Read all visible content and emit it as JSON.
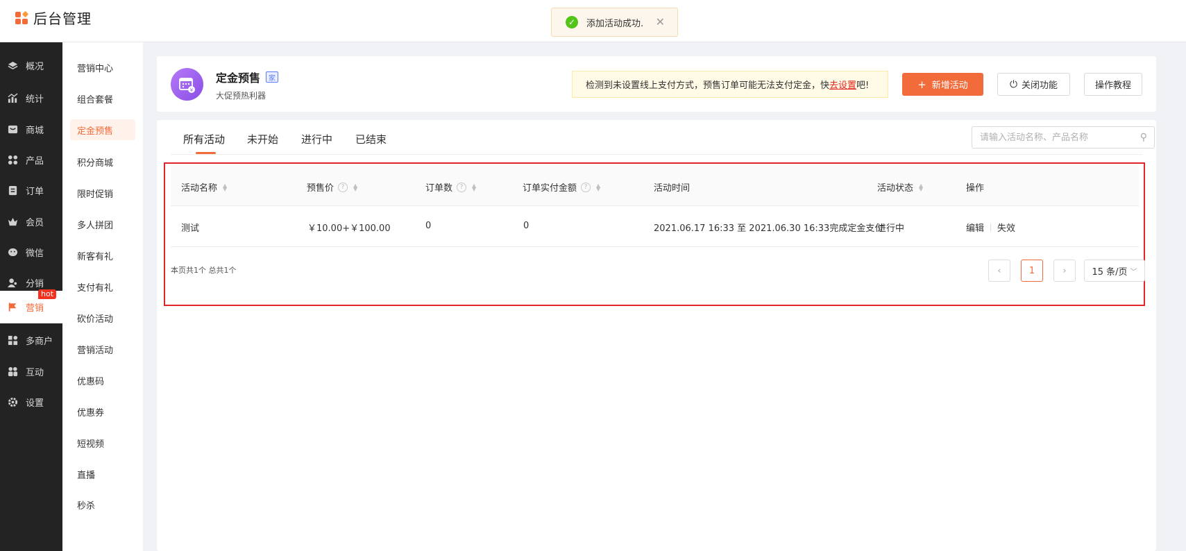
{
  "app": {
    "title": "后台管理"
  },
  "toast": {
    "text": "添加活动成功."
  },
  "sidebar": {
    "items": [
      {
        "label": "概况",
        "icon": "layers-icon"
      },
      {
        "label": "统计",
        "icon": "stats-icon"
      },
      {
        "label": "商城",
        "icon": "store-icon"
      },
      {
        "label": "产品",
        "icon": "product-icon"
      },
      {
        "label": "订单",
        "icon": "order-icon"
      },
      {
        "label": "会员",
        "icon": "crown-icon"
      },
      {
        "label": "微信",
        "icon": "wechat-icon"
      },
      {
        "label": "分销",
        "icon": "distribution-icon"
      },
      {
        "label": "营销",
        "icon": "flag-icon",
        "badge": "hot",
        "active": true
      },
      {
        "label": "多商户",
        "icon": "merchant-icon"
      },
      {
        "label": "互动",
        "icon": "interaction-icon"
      },
      {
        "label": "设置",
        "icon": "gear-icon"
      }
    ]
  },
  "subnav": {
    "items": [
      "营销中心",
      "组合套餐",
      "定金预售",
      "积分商城",
      "限时促销",
      "多人拼团",
      "新客有礼",
      "支付有礼",
      "砍价活动",
      "营销活动",
      "优惠码",
      "优惠券",
      "短视频",
      "直播",
      "秒杀"
    ],
    "active": "定金预售"
  },
  "header": {
    "title": "定金预售",
    "tag": "家",
    "subtitle": "大促预热利器",
    "warning_prefix": "检测到未设置线上支付方式，预售订单可能无法支付定金，快",
    "warning_link": "去设置",
    "warning_suffix": "吧!",
    "add_button": "新增活动",
    "close_button": "关闭功能",
    "guide_button": "操作教程"
  },
  "tabs": [
    "所有活动",
    "未开始",
    "进行中",
    "已结束"
  ],
  "search": {
    "placeholder": "请输入活动名称、产品名称"
  },
  "table": {
    "columns": [
      "活动名称",
      "预售价",
      "订单数",
      "订单实付金额",
      "活动时间",
      "活动状态",
      "操作"
    ],
    "rows": [
      {
        "name": "测试",
        "price": "￥10.00+￥100.00",
        "orders": "0",
        "amount": "0",
        "time": "2021.06.17 16:33 至 2021.06.30 16:33完成定金支付",
        "status": "进行中",
        "action_edit": "编辑",
        "action_disable": "失效"
      }
    ]
  },
  "pagination": {
    "info": "本页共1个 总共1个",
    "current": "1",
    "page_size": "15 条/页"
  },
  "colors": {
    "accent": "#f26b3a",
    "sidebar_bg": "#232323",
    "highlight_border": "#e0242a"
  }
}
